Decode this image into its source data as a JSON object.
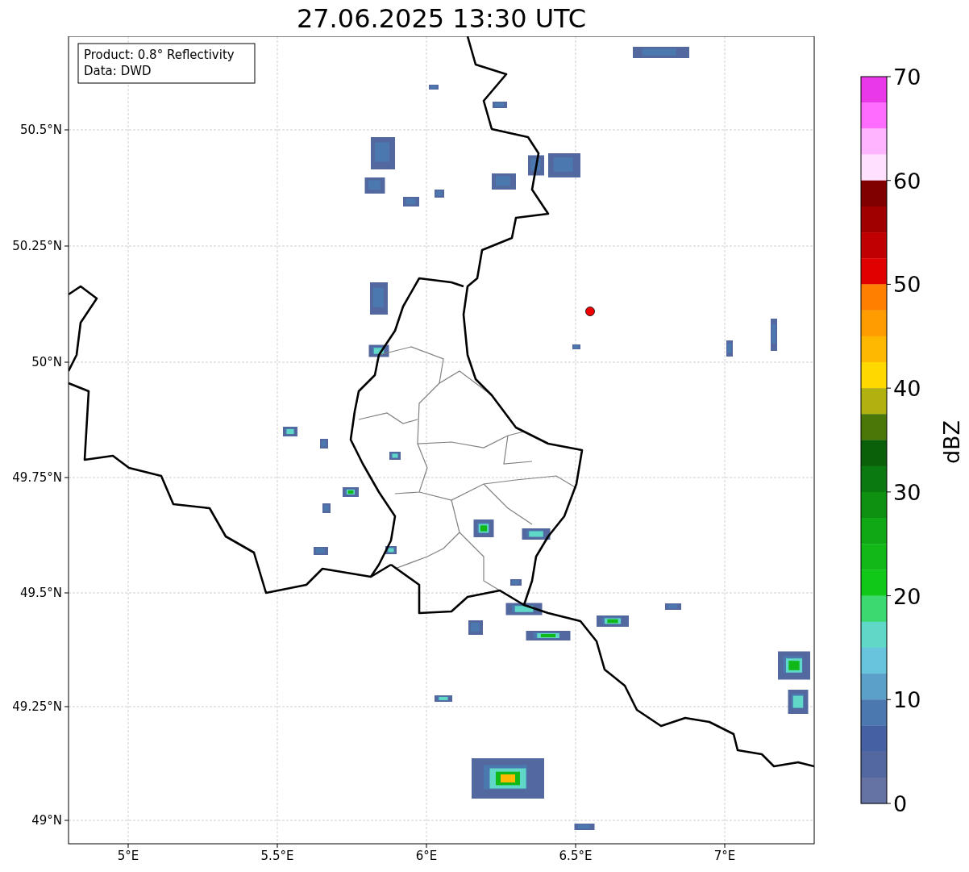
{
  "title": "27.06.2025 13:30 UTC",
  "legend": {
    "lines": [
      "Product: 0.8° Reflectivity",
      "Data: DWD"
    ]
  },
  "x_axis": {
    "tick_labels": [
      "5°E",
      "5.5°E",
      "6°E",
      "6.5°E",
      "7°E"
    ]
  },
  "y_axis": {
    "tick_labels": [
      "50.5°N",
      "50.25°N",
      "50°N",
      "49.75°N",
      "49.5°N",
      "49.25°N",
      "49°N"
    ]
  },
  "colorbar": {
    "label": "dBZ",
    "tick_labels": [
      "70",
      "60",
      "50",
      "40",
      "30",
      "20",
      "10",
      "0"
    ],
    "bins": [
      {
        "color": "#e838e8"
      },
      {
        "color": "#ff6cff"
      },
      {
        "color": "#ffb4ff"
      },
      {
        "color": "#ffe0ff"
      },
      {
        "color": "#800000"
      },
      {
        "color": "#a00000"
      },
      {
        "color": "#c00000"
      },
      {
        "color": "#e00000"
      },
      {
        "color": "#ff8000"
      },
      {
        "color": "#ff9c00"
      },
      {
        "color": "#ffb800"
      },
      {
        "color": "#ffd800"
      },
      {
        "color": "#b0b010"
      },
      {
        "color": "#4a7808"
      },
      {
        "color": "#0a6008"
      },
      {
        "color": "#0a7a10"
      },
      {
        "color": "#0e9010"
      },
      {
        "color": "#10a814"
      },
      {
        "color": "#12b818"
      },
      {
        "color": "#10c818"
      },
      {
        "color": "#3cd870"
      },
      {
        "color": "#60d8c8"
      },
      {
        "color": "#68c4dc"
      },
      {
        "color": "#5aa0c8"
      },
      {
        "color": "#4c78b0"
      },
      {
        "color": "#4660a4"
      },
      {
        "color": "#5468a0"
      },
      {
        "color": "#6472a4"
      }
    ]
  }
}
